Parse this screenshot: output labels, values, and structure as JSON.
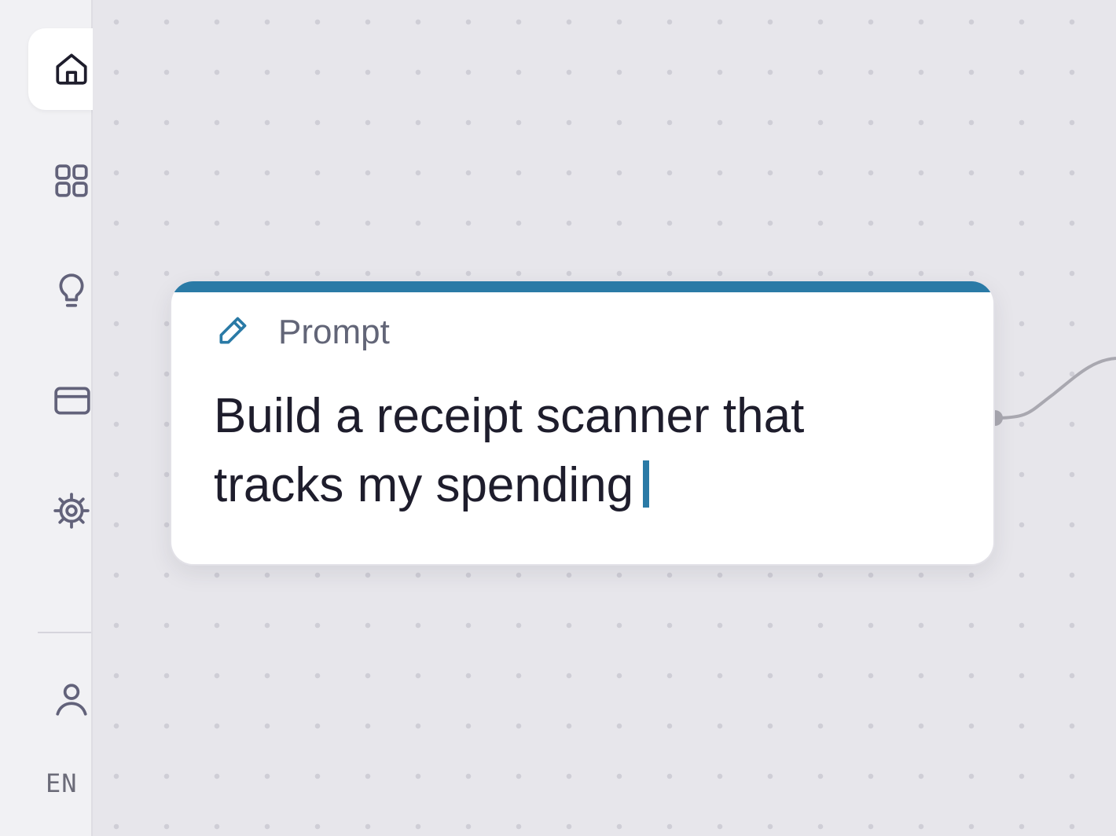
{
  "sidebar": {
    "items": [
      {
        "name": "home",
        "icon": "home-icon",
        "active": true
      },
      {
        "name": "apps",
        "icon": "grid-icon",
        "active": false
      },
      {
        "name": "ideas",
        "icon": "lightbulb-icon",
        "active": false
      },
      {
        "name": "billing",
        "icon": "credit-card-icon",
        "active": false
      },
      {
        "name": "settings",
        "icon": "gear-icon",
        "active": false
      }
    ],
    "profile_icon": "user-icon",
    "language": "EN"
  },
  "node": {
    "icon": "pencil-icon",
    "title": "Prompt",
    "text": "Build a receipt scanner that tracks my spending",
    "accent_color": "#2a7aa6"
  },
  "colors": {
    "canvas": "#e7e6eb",
    "sidebar": "#f1f1f4",
    "accent": "#2a7aa6",
    "text": "#1e1d2c"
  }
}
